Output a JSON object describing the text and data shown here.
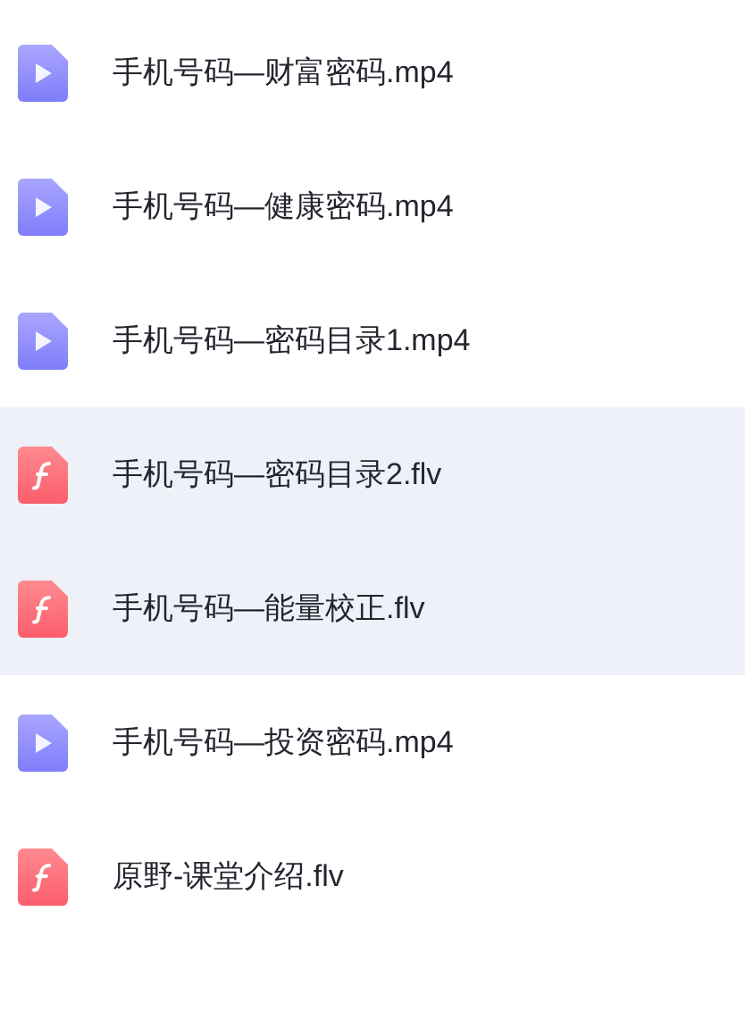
{
  "files": [
    {
      "name": "手机号码—财富密码.mp4",
      "kind": "video",
      "highlighted": false
    },
    {
      "name": "手机号码—健康密码.mp4",
      "kind": "video",
      "highlighted": false
    },
    {
      "name": "手机号码—密码目录1.mp4",
      "kind": "video",
      "highlighted": false
    },
    {
      "name": "手机号码—密码目录2.flv",
      "kind": "flash",
      "highlighted": true
    },
    {
      "name": "手机号码—能量校正.flv",
      "kind": "flash",
      "highlighted": true
    },
    {
      "name": "手机号码—投资密码.mp4",
      "kind": "video",
      "highlighted": false
    },
    {
      "name": "原野-课堂介绍.flv",
      "kind": "flash",
      "highlighted": false
    }
  ]
}
